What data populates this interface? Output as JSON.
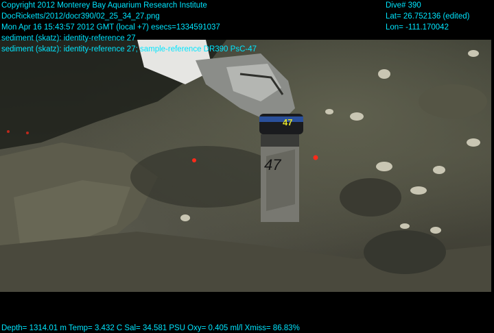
{
  "overlay": {
    "left_lines": [
      "Copyright 2012 Monterey Bay Aquarium Research Institute",
      "DocRicketts/2012/docr390/02_25_34_27.png",
      "Mon Apr 16 15:43:57 2012 GMT (local +7)  esecs=1334591037",
      "sediment (skatz): identity-reference 27",
      "sediment (skatz): identity-reference 27; sample-reference DR390 PsC-47"
    ],
    "right_lines": [
      "Dive# 390",
      "Lat= 26.752136 (edited)",
      "Lon= -111.170042"
    ],
    "bottom_line": "Depth= 1314.01 m  Temp= 3.432 C  Sal= 34.581 PSU  Oxy= 0.405 ml/l  Xmiss= 86.83%"
  },
  "scene": {
    "tube_marking": "47",
    "tube_cap_marking": "47"
  },
  "colors": {
    "overlay_text": "#00e6ff",
    "laser_dot": "#ff2a1a"
  }
}
